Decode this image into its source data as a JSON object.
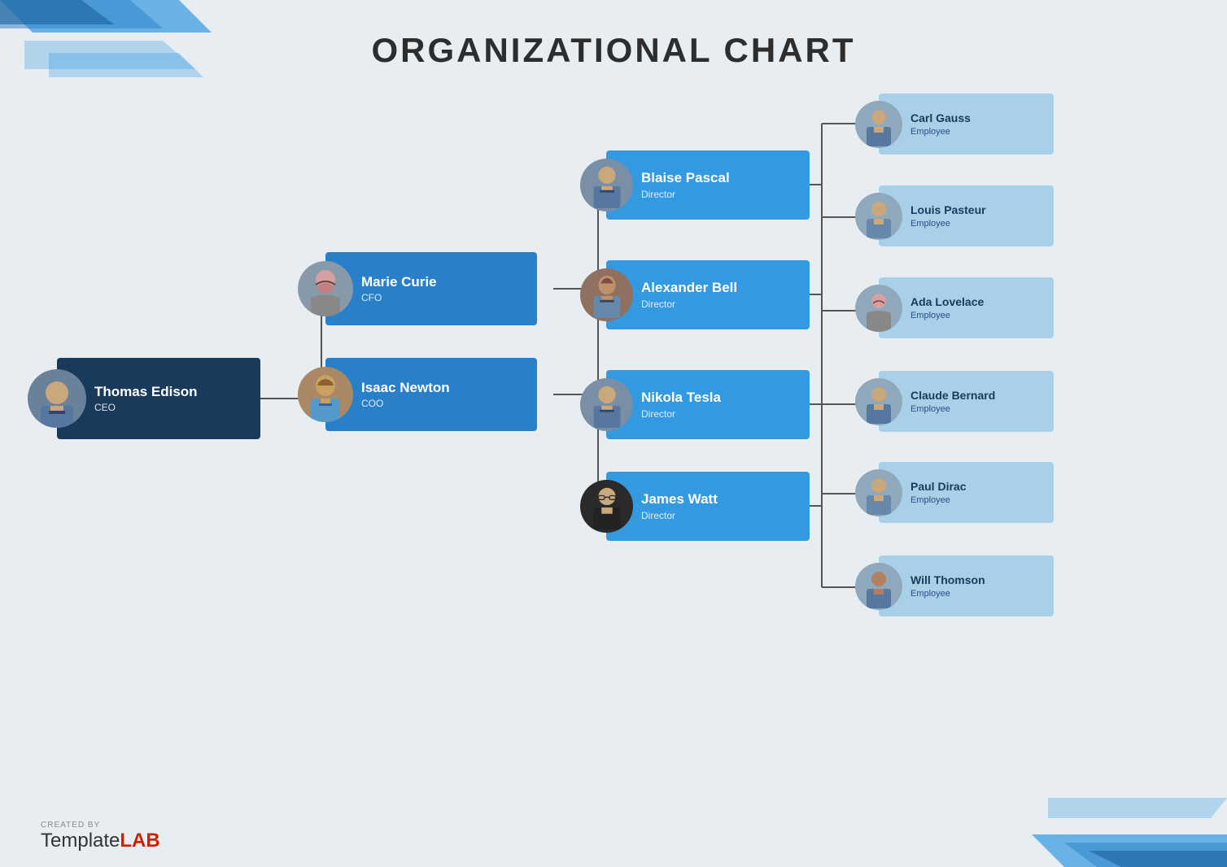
{
  "title": "ORGANIZATIONAL CHART",
  "nodes": {
    "ceo": {
      "name": "Thomas Edison",
      "role": "CEO"
    },
    "cfo": {
      "name": "Marie Curie",
      "role": "CFO"
    },
    "coo": {
      "name": "Isaac Newton",
      "role": "COO"
    },
    "pascal": {
      "name": "Blaise Pascal",
      "role": "Director"
    },
    "bell": {
      "name": "Alexander Bell",
      "role": "Director"
    },
    "tesla": {
      "name": "Nikola Tesla",
      "role": "Director"
    },
    "watt": {
      "name": "James Watt",
      "role": "Director"
    },
    "gauss": {
      "name": "Carl Gauss",
      "role": "Employee"
    },
    "pasteur": {
      "name": "Louis Pasteur",
      "role": "Employee"
    },
    "lovelace": {
      "name": "Ada Lovelace",
      "role": "Employee"
    },
    "bernard": {
      "name": "Claude Bernard",
      "role": "Employee"
    },
    "dirac": {
      "name": "Paul Dirac",
      "role": "Employee"
    },
    "thomson": {
      "name": "Will Thomson",
      "role": "Employee"
    }
  },
  "watermark": {
    "created_by": "CREATED BY",
    "brand_light": "Template",
    "brand_bold": "LAB"
  },
  "colors": {
    "ceo_bg": "#1a3a5c",
    "mid_bg": "#2980c8",
    "dir_bg": "#3399e0",
    "emp_bg": "#a8d0e8",
    "accent": "#2980c8"
  }
}
